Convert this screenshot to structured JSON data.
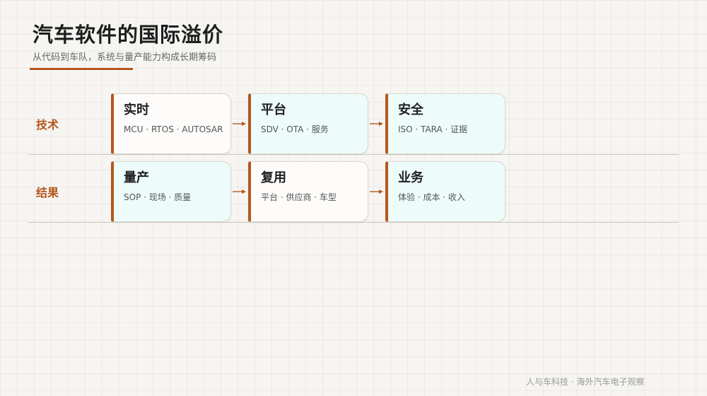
{
  "header": {
    "title": "汽车软件的国际溢价",
    "subtitle": "从代码到车队，系统与量产能力构成长期筹码"
  },
  "rows": [
    {
      "label": "技术",
      "cards": [
        {
          "title": "实时",
          "desc": "MCU · RTOS · AUTOSAR"
        },
        {
          "title": "平台",
          "desc": "SDV · OTA · 服务"
        },
        {
          "title": "安全",
          "desc": "ISO · TARA · 证据"
        }
      ]
    },
    {
      "label": "结果",
      "cards": [
        {
          "title": "量产",
          "desc": "SOP · 现场 · 质量"
        },
        {
          "title": "复用",
          "desc": "平台 · 供应商 · 车型"
        },
        {
          "title": "业务",
          "desc": "体验 · 成本 · 收入"
        }
      ]
    }
  ],
  "footer": "人与车科技 · 海外汽车电子观察",
  "colors": {
    "accent": "#b5571c",
    "card_white": "#fdfcfa",
    "card_cyan": "#edfcfb"
  }
}
